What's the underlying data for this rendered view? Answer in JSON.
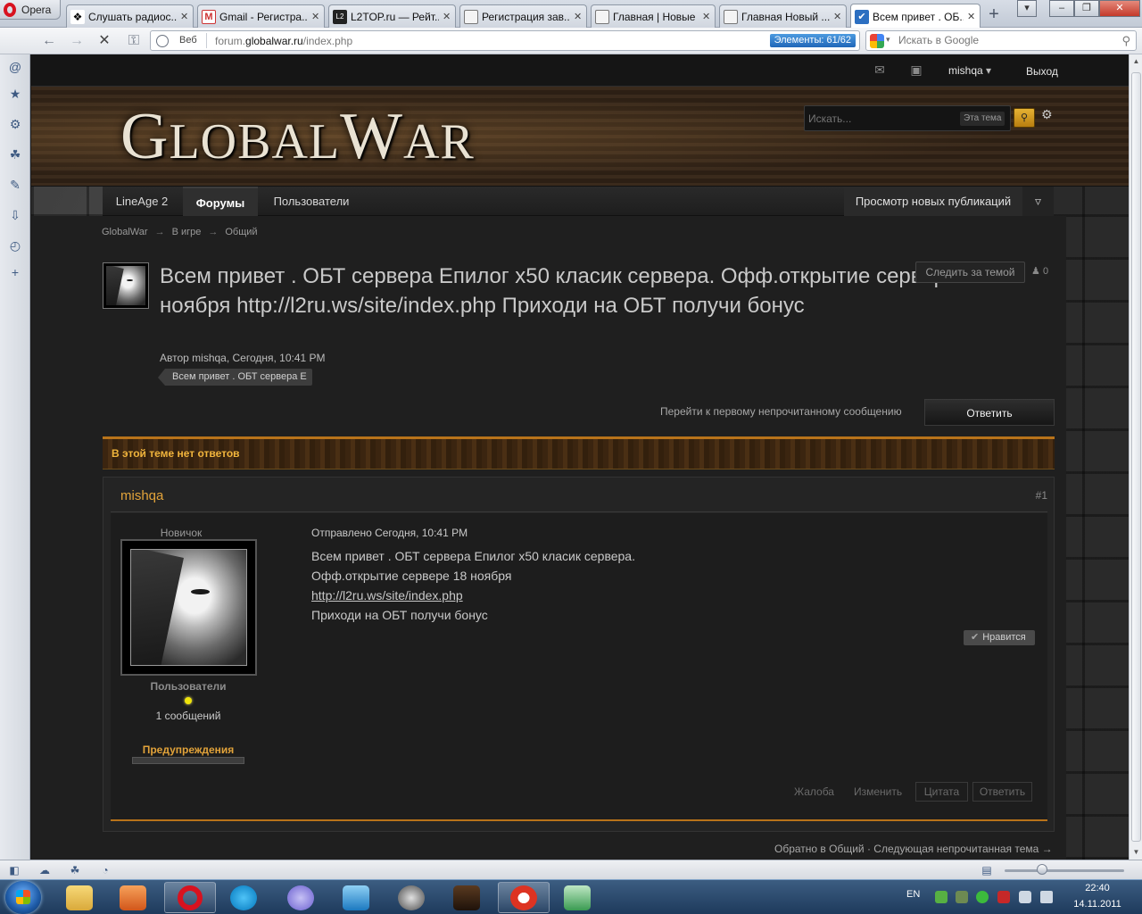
{
  "browser": {
    "opera_button": "Opera",
    "tabs": [
      {
        "label": "Слушать радиос...",
        "icon": "paw-icon",
        "active": false
      },
      {
        "label": "Gmail - Регистра...",
        "icon": "gmail-icon",
        "active": false
      },
      {
        "label": "L2TOP.ru — Рейт...",
        "icon": "l2top-icon",
        "active": false
      },
      {
        "label": "Регистрация зав...",
        "icon": "page-icon",
        "active": false
      },
      {
        "label": "Главная | Новые ...",
        "icon": "page-icon",
        "active": false
      },
      {
        "label": "Главная Новый ...",
        "icon": "page-icon",
        "active": false
      },
      {
        "label": "Всем привет . ОБ...",
        "icon": "check-icon",
        "active": true
      }
    ],
    "address_prefix": "Веб",
    "url_host_pre": "forum.",
    "url_host": "globalwar.ru",
    "url_path": "/index.php",
    "elements_badge": "Элементы:   61/62",
    "search_placeholder": "Искать в Google",
    "clock_time": "22:40",
    "clock_date": "14.11.2011",
    "lang": "EN"
  },
  "forum": {
    "user_name": "mishqa",
    "logout": "Выход",
    "logo_first": "G",
    "logo_rest1": "LOBAL",
    "logo_w": "W",
    "logo_rest2": "AR",
    "search_placeholder": "Искать...",
    "search_scope": "Эта тема",
    "nav": {
      "tabs": [
        "LineAge 2",
        "Форумы",
        "Пользователи"
      ],
      "new_posts": "Просмотр новых публикаций"
    },
    "breadcrumb": [
      "GlobalWar",
      "В игре",
      "Общий"
    ],
    "topic": {
      "title": "Всем привет . ОБТ сервера Епилог x50 класик сервера. Офф.открытие сервере 18 ноября http://l2ru.ws/site/index.php Приходи на ОБТ получи бонус",
      "meta": "Автор mishqa, Сегодня, 10:41 PM",
      "tag": "Всем привет . ОБТ сервера Е",
      "follow": "Следить за темой",
      "followers": "0",
      "first_unread": "Перейти к первому непрочитанному сообщению",
      "reply": "Ответить",
      "no_replies": "В этой теме нет ответов"
    },
    "post": {
      "author": "mishqa",
      "number": "#1",
      "rank": "Новичок",
      "group": "Пользователи",
      "post_count": "1 сообщений",
      "warnings": "Предупреждения",
      "date": "Отправлено Сегодня, 10:41 PM",
      "lines": [
        "Всем привет . ОБТ сервера Епилог x50 класик сервера.",
        "Офф.открытие сервере 18 ноября"
      ],
      "link": "http://l2ru.ws/site/index.php",
      "last_line": "Приходи на ОБТ получи бонус",
      "like": "Нравится",
      "report": "Жалоба",
      "edit": "Изменить",
      "quote": "Цитата",
      "reply": "Ответить"
    },
    "bottom": {
      "back": "Обратно в Общий",
      "sep": " · ",
      "next": "Следующая непрочитанная тема →"
    }
  },
  "colors": {
    "accent_orange": "#e2a33a",
    "online_dot": "#f0e40a"
  }
}
